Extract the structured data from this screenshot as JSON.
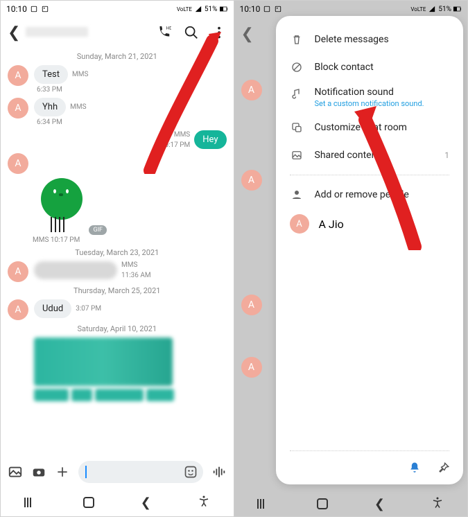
{
  "status": {
    "time": "10:10",
    "battery": "51%",
    "network": "LTE2",
    "volte": "VoLTE"
  },
  "left": {
    "avatar_letter": "A",
    "dates": {
      "d1": "Sunday, March 21, 2021",
      "d2": "Tuesday, March 23, 2021",
      "d3": "Thursday, March 25, 2021",
      "d4": "Saturday, April 10, 2021"
    },
    "mms_label": "MMS",
    "msg1": {
      "text": "Test",
      "time": "6:33 PM"
    },
    "msg2": {
      "text": "Yhh",
      "time": "6:34 PM"
    },
    "out1": {
      "text": "Hey",
      "time": "10:17 PM"
    },
    "sticker_time": "MMS 10:17 PM",
    "gif_badge": "GIF",
    "msg3": {
      "time": "11:36 AM"
    },
    "msg4": {
      "text": "Udud",
      "time": "3:07 PM"
    }
  },
  "right": {
    "avatar_letter": "A",
    "menu": {
      "delete": "Delete messages",
      "block": "Block contact",
      "notif": "Notification sound",
      "notif_sub": "Set a custom notification sound.",
      "customize": "Customize chat room",
      "shared": "Shared content",
      "shared_count": "1",
      "add_people": "Add or remove people",
      "person1": "A Jio"
    }
  }
}
